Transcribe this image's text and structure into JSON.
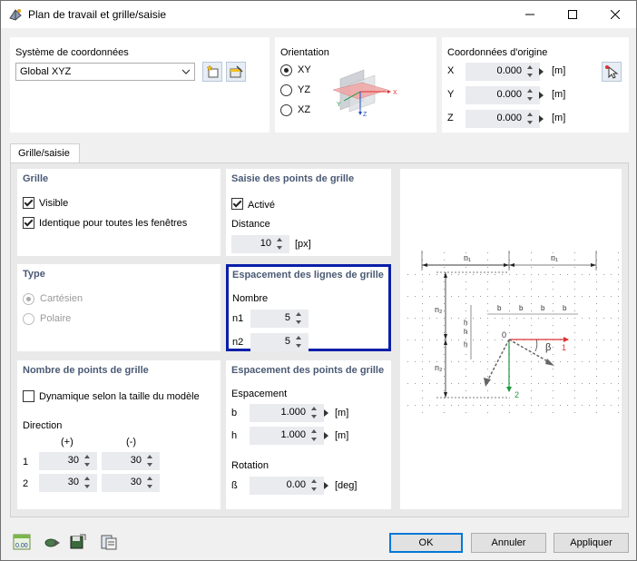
{
  "window": {
    "title": "Plan de travail et grille/saisie"
  },
  "coord_system": {
    "label": "Système de coordonnées",
    "selected": "Global XYZ",
    "new_icon": "new-coordinate-system-icon",
    "edit_icon": "edit-coordinate-system-icon"
  },
  "orientation": {
    "label": "Orientation",
    "options": [
      "XY",
      "YZ",
      "XZ"
    ],
    "selected": "XY",
    "axis_x": "X",
    "axis_y": "Y",
    "axis_z": "Z"
  },
  "origin": {
    "label": "Coordonnées d'origine",
    "rows": [
      {
        "axis": "X",
        "value": "0.000",
        "unit": "[m]"
      },
      {
        "axis": "Y",
        "value": "0.000",
        "unit": "[m]"
      },
      {
        "axis": "Z",
        "value": "0.000",
        "unit": "[m]"
      }
    ]
  },
  "tab": {
    "label": "Grille/saisie"
  },
  "grid": {
    "label": "Grille",
    "visible_label": "Visible",
    "visible_checked": true,
    "identical_label": "Identique pour toutes les fenêtres",
    "identical_checked": true
  },
  "snap": {
    "label": "Saisie des points de grille",
    "active_label": "Activé",
    "active_checked": true,
    "distance_label": "Distance",
    "distance_value": "10",
    "distance_unit": "[px]"
  },
  "type": {
    "label": "Type",
    "options": [
      "Cartésien",
      "Polaire"
    ],
    "selected": "Cartésien",
    "disabled": true
  },
  "line_spacing": {
    "label": "Espacement des lignes de grille",
    "count_label": "Nombre",
    "n1_label": "n1",
    "n1_value": "5",
    "n2_label": "n2",
    "n2_value": "5"
  },
  "grid_points": {
    "label": "Nombre de points de grille",
    "dynamic_label": "Dynamique selon la taille du modèle",
    "dynamic_checked": false,
    "direction_label": "Direction",
    "col_plus": "(+)",
    "col_minus": "(-)",
    "rows": [
      {
        "label": "1",
        "plus": "30",
        "minus": "30"
      },
      {
        "label": "2",
        "plus": "30",
        "minus": "30"
      }
    ]
  },
  "point_spacing": {
    "label": "Espacement des points de grille",
    "spacing_label": "Espacement",
    "b_label": "b",
    "b_value": "1.000",
    "b_unit": "[m]",
    "h_label": "h",
    "h_value": "1.000",
    "h_unit": "[m]",
    "rotation_label": "Rotation",
    "beta_label": "ß",
    "beta_value": "0.00",
    "beta_unit": "[deg]"
  },
  "diagram": {
    "n1": "n₁",
    "n2": "n₂",
    "b": "b",
    "h": "h",
    "origin": "0",
    "beta": "β",
    "axis1": "1",
    "axis2": "2"
  },
  "buttons": {
    "ok": "OK",
    "cancel": "Annuler",
    "apply": "Appliquer"
  },
  "bottom_icons": [
    "units-icon",
    "display-icon",
    "save-icon",
    "clipboard-icon"
  ],
  "bottom_units_text": "0.00",
  "colors": {
    "accent_blue": "#0a1fa8",
    "section_title": "#4a5a74",
    "axis_red": "#e03030",
    "axis_green": "#1a9a3a"
  }
}
